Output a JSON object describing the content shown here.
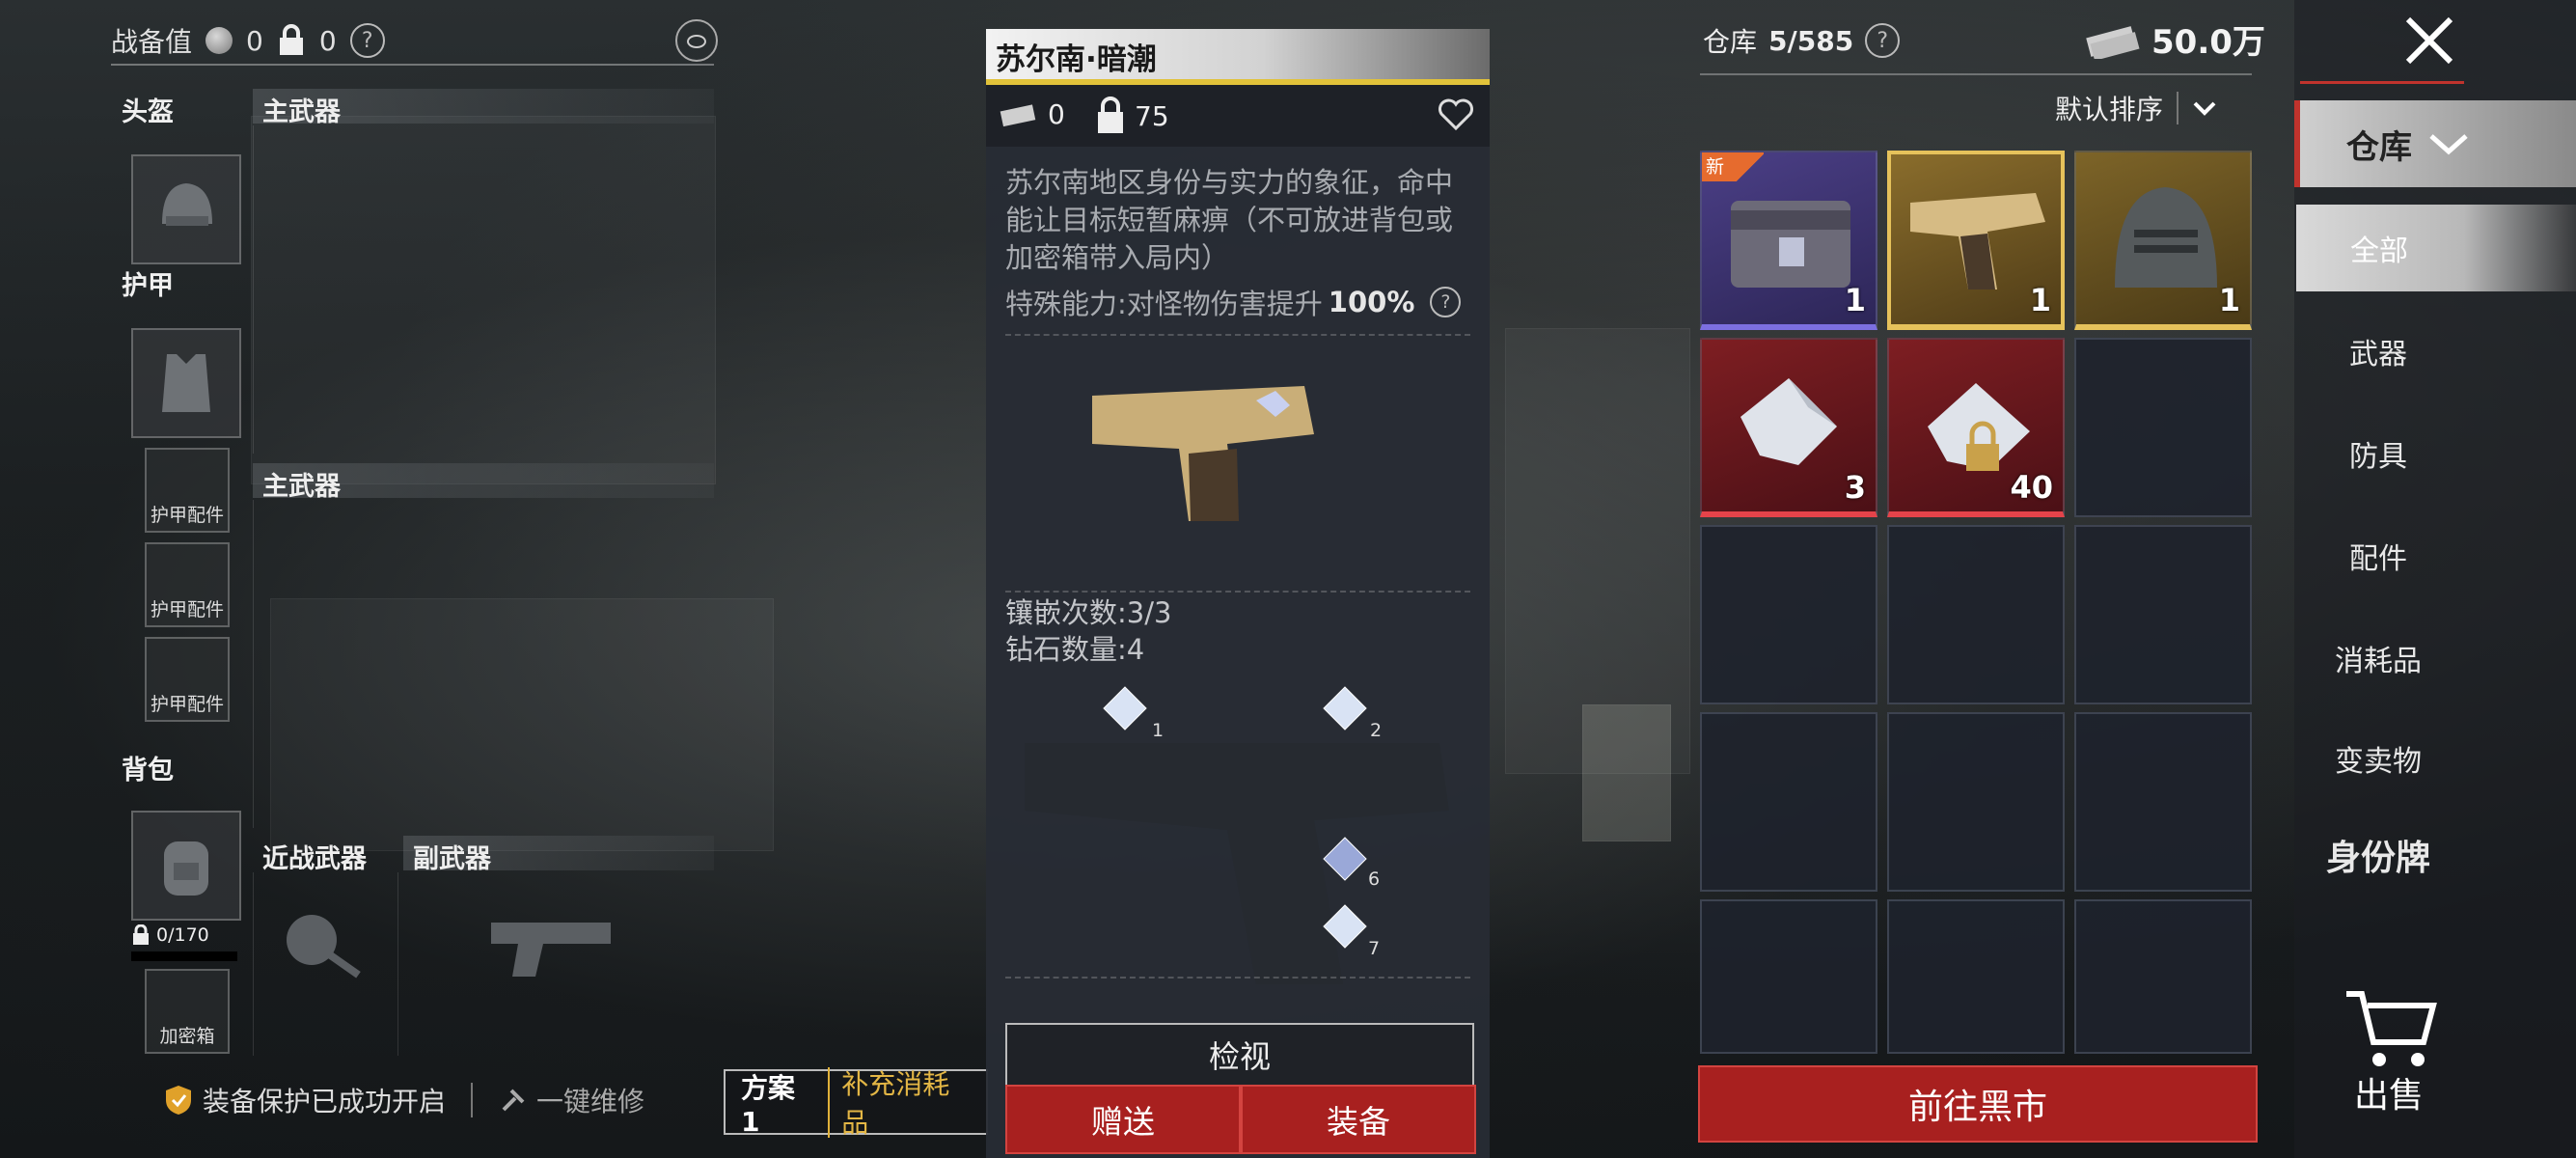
{
  "loadout": {
    "title": "战备值",
    "coin_value": "0",
    "lock_value": "0",
    "slots": {
      "helmet": "头盔",
      "primary1": "主武器",
      "armor": "护甲",
      "primary2": "主武器",
      "armor_attach": [
        "护甲配件",
        "护甲配件",
        "护甲配件"
      ],
      "backpack": "背包",
      "melee": "近战武器",
      "secondary": "副武器",
      "backpack_capacity": "0/170",
      "safe_box": "加密箱"
    },
    "protection": "装备保护已成功开启",
    "repair": "一键维修",
    "plan": "方案1",
    "refill": "补充消耗品"
  },
  "detail": {
    "name": "苏尔南·暗潮",
    "cash": "0",
    "lock": "75",
    "description": "苏尔南地区身份与实力的象征，命中能让目标短暂麻痹（不可放进背包或加密箱带入局内）",
    "special_label": "特殊能力:对怪物伤害提升",
    "special_value": "100%",
    "inlay": "镶嵌次数:3/3",
    "diamonds": "钻石数量:4",
    "gem_slots": [
      "1",
      "2",
      "6",
      "7"
    ],
    "view_button": "检视",
    "gift_button": "赠送",
    "equip_button": "装备"
  },
  "warehouse": {
    "title": "仓库",
    "capacity": "5/585",
    "money": "50.0万",
    "sort": "默认排序",
    "items": [
      {
        "name": "supply-crate",
        "count": "1",
        "rarity": "purple",
        "tag": "新"
      },
      {
        "name": "golden-pistol",
        "count": "1",
        "rarity": "gold"
      },
      {
        "name": "armored-helmet",
        "count": "1",
        "rarity": "gold"
      },
      {
        "name": "diamond-shards",
        "count": "3",
        "rarity": "red"
      },
      {
        "name": "locked-diamonds",
        "count": "40",
        "rarity": "red"
      }
    ],
    "market_button": "前往黑市"
  },
  "nav": {
    "warehouse": "仓库",
    "all": "全部",
    "items": [
      "武器",
      "防具",
      "配件",
      "消耗品",
      "变卖物"
    ],
    "dogtag": "身份牌",
    "sell": "出售"
  },
  "colors": {
    "accent_red": "#a8201f",
    "gold": "#e6c25b",
    "purple": "#7c6fe0"
  }
}
